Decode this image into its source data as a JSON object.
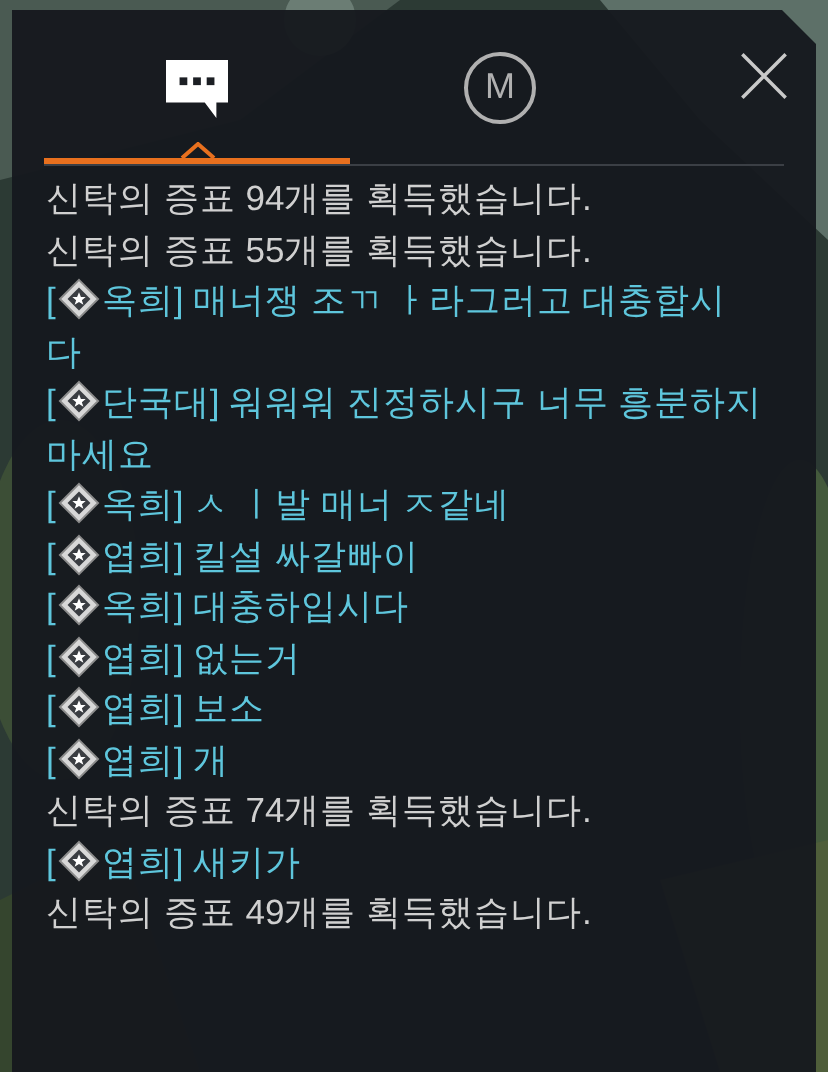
{
  "tabs": [
    {
      "kind": "chat",
      "selected": true
    },
    {
      "kind": "mission",
      "label": "M",
      "selected": false
    }
  ],
  "messages": [
    {
      "kind": "system",
      "text": "신탁의 증표 94개를 획득했습니다."
    },
    {
      "kind": "system",
      "text": "신탁의 증표 55개를 획득했습니다."
    },
    {
      "kind": "chat",
      "prefix": "[",
      "text": "옥희] 매너쟁 조ㄲ ㅏ라그러고 대충합시",
      "continuation": "다"
    },
    {
      "kind": "chat",
      "prefix": "[",
      "text": "단국대] 워워워 진정하시구 너무 흥분하지",
      "continuation": "마세요"
    },
    {
      "kind": "chat",
      "prefix": "[",
      "text": "옥희] ㅅ ㅣ발 매너 ㅈ같네"
    },
    {
      "kind": "chat",
      "prefix": "[",
      "text": "엽희] 킬설 싸갈빠이"
    },
    {
      "kind": "chat",
      "prefix": "[",
      "text": "옥희] 대충하입시다"
    },
    {
      "kind": "chat",
      "prefix": "[",
      "text": "엽희] 없는거"
    },
    {
      "kind": "chat",
      "prefix": "[",
      "text": "엽희] 보소"
    },
    {
      "kind": "chat",
      "prefix": "[",
      "text": "엽희] 개"
    },
    {
      "kind": "system",
      "text": "신탁의 증표 74개를 획득했습니다."
    },
    {
      "kind": "chat",
      "prefix": "[",
      "text": "엽희] 새키가"
    },
    {
      "kind": "system",
      "text": "신탁의 증표 49개를 획득했습니다."
    }
  ]
}
